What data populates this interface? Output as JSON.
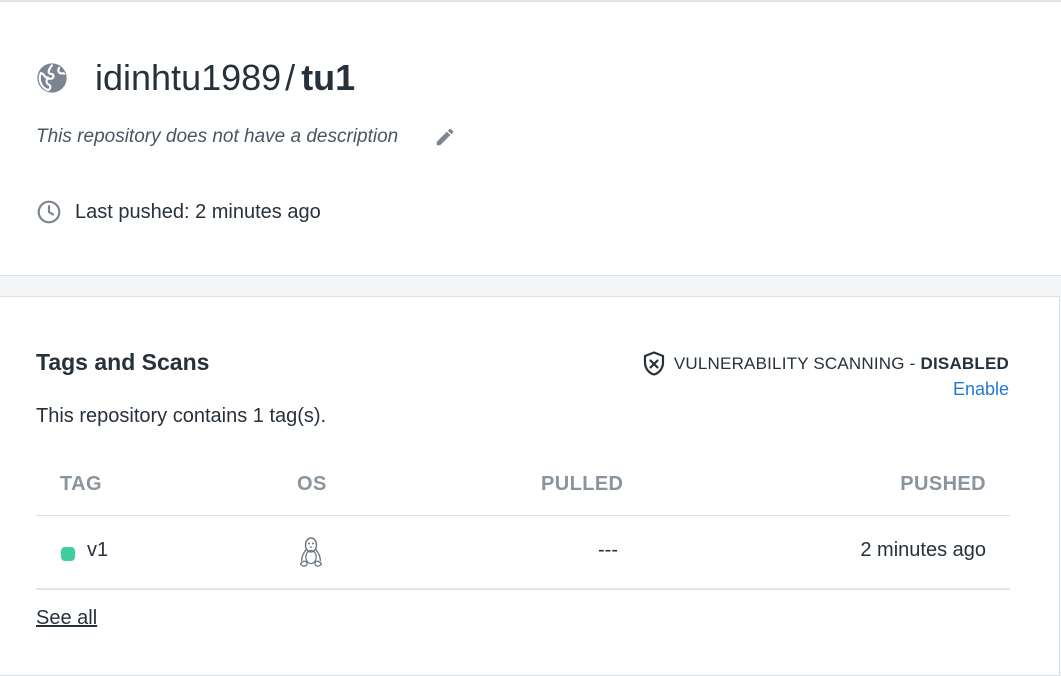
{
  "repo": {
    "namespace": "idinhtu1989",
    "separator": "/",
    "name": "tu1",
    "visibility_icon": "globe-icon",
    "description": "This repository does not have a description",
    "edit_icon": "pencil-icon",
    "last_pushed": "Last pushed: 2 minutes ago",
    "clock_icon": "clock-icon"
  },
  "tags_section": {
    "title": "Tags and Scans",
    "vuln_label": "VULNERABILITY SCANNING -",
    "vuln_status": "DISABLED",
    "enable_label": "Enable",
    "contains_text": "This repository contains 1 tag(s).",
    "columns": [
      "TAG",
      "OS",
      "PULLED",
      "PUSHED"
    ],
    "rows": [
      {
        "tag": "v1",
        "tag_color": "#3fcf9c",
        "os_icon": "linux-tux-icon",
        "pulled": "---",
        "pushed": "2 minutes ago"
      }
    ],
    "see_all_label": "See all"
  },
  "colors": {
    "link": "#1f7ad6",
    "text": "#27313b",
    "muted": "#8a949e"
  }
}
